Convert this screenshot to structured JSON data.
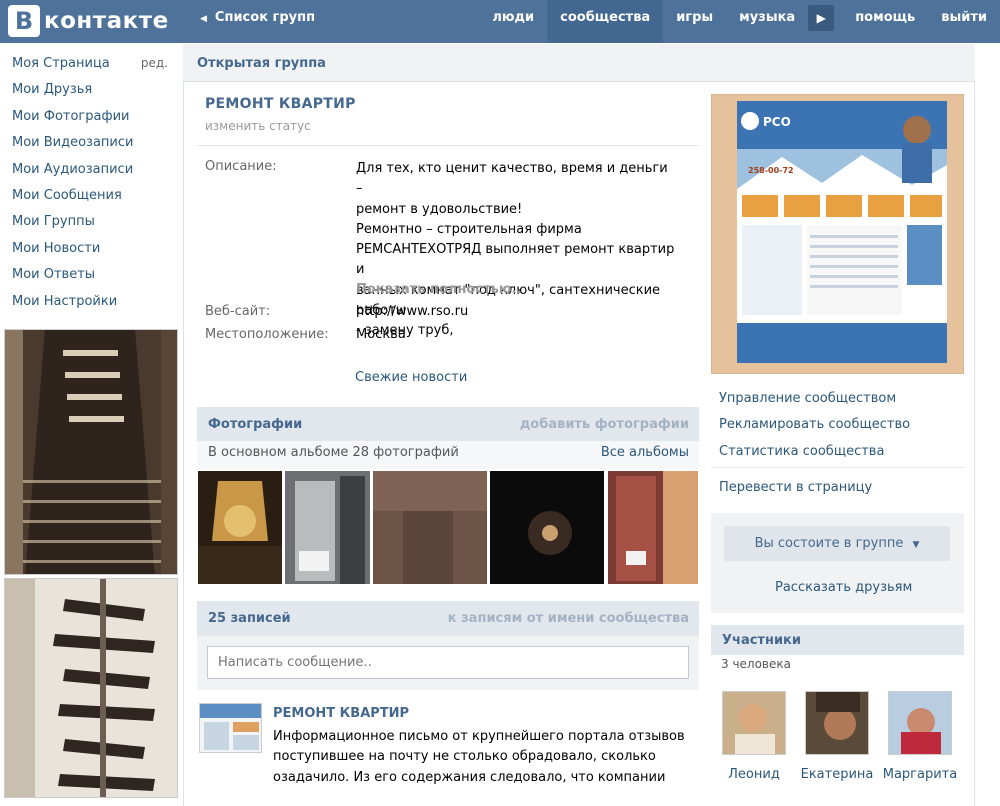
{
  "topbar": {
    "logo_letter": "В",
    "logo_text": "контакте",
    "back_label": "Список групп",
    "nav": [
      "люди",
      "сообщества",
      "игры",
      "музыка",
      "помощь",
      "выйти"
    ],
    "active_nav": "сообщества"
  },
  "sidebar": {
    "edit_label": "ред.",
    "items": [
      "Моя Страница",
      "Мои Друзья",
      "Мои Фотографии",
      "Мои Видеозаписи",
      "Мои Аудиозаписи",
      "Мои Сообщения",
      "Мои Группы",
      "Мои Новости",
      "Мои Ответы",
      "Мои Настройки"
    ]
  },
  "main": {
    "header": "Открытая группа",
    "group_name": "РЕМОНТ КВАРТИР",
    "change_status": "изменить статус",
    "description_label": "Описание:",
    "description_lines": [
      "Для тех, кто ценит качество, время и деньги –",
      "ремонт в удовольствие!",
      "Ремонтно – строительная фирма",
      "РЕМСАНТЕХОТРЯД выполняет ремонт квартир и",
      "ванных комнат \"под ключ\", сантехнические работы",
      "- замену труб,"
    ],
    "show_full": "Показать полностью..",
    "website_label": "Веб-сайт:",
    "website_value": "http://www.rso.ru",
    "location_label": "Местоположение:",
    "location_value": "Москва",
    "fresh_news": "Свежие новости",
    "photos": {
      "title": "Фотографии",
      "add": "добавить фотографии",
      "album_info": "В основном альбоме 28 фотографий",
      "all_albums": "Все альбомы"
    },
    "wall": {
      "count": "25 записей",
      "as_community": "к записям от имени сообщества",
      "placeholder": "Написать сообщение..",
      "post_author": "РЕМОНТ КВАРТИР",
      "post_lines": [
        "Информационное письмо от крупнейшего портала отзывов",
        "поступившее на почту не столько обрадовало, сколько",
        "озадачило. Из его содержания следовало, что компании"
      ]
    }
  },
  "right": {
    "actions": [
      "Управление сообществом",
      "Рекламировать сообщество",
      "Статистика сообщества"
    ],
    "convert": "Перевести в страницу",
    "member_button": "Вы состоите в группе",
    "tell_friends": "Рассказать друзьям",
    "members_title": "Участники",
    "members_count": "3 человека",
    "members": [
      "Леонид",
      "Екатерина",
      "Маргарита"
    ]
  },
  "cover_image": {
    "logo": "РСО",
    "phone": "258-00-72"
  }
}
